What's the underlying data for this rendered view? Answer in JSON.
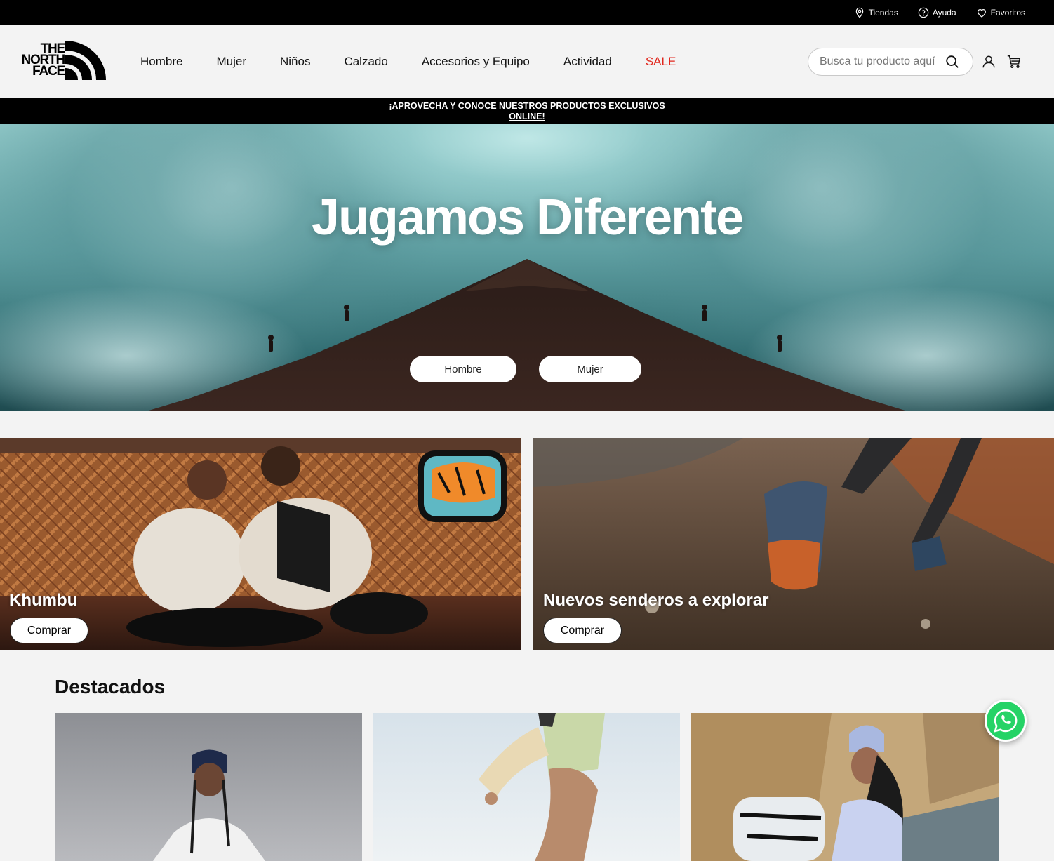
{
  "utility_bar": {
    "stores_label": "Tiendas",
    "help_label": "Ayuda",
    "favorites_label": "Favoritos"
  },
  "header": {
    "logo_lines": [
      "THE",
      "NORTH",
      "FACE"
    ],
    "nav": [
      {
        "label": "Hombre"
      },
      {
        "label": "Mujer"
      },
      {
        "label": "Niños"
      },
      {
        "label": "Calzado"
      },
      {
        "label": "Accesorios y Equipo"
      },
      {
        "label": "Actividad"
      },
      {
        "label": "SALE"
      }
    ],
    "search_placeholder": "Busca tu producto aquí"
  },
  "promo": {
    "text": "¡APROVECHA Y CONOCE NUESTROS PRODUCTOS EXCLUSIVOS",
    "link": "ONLINE!"
  },
  "hero": {
    "title": "Jugamos Diferente",
    "buttons": [
      "Hombre",
      "Mujer"
    ]
  },
  "cards": [
    {
      "title": "Khumbu",
      "button": "Comprar"
    },
    {
      "title": "Nuevos senderos a explorar",
      "button": "Comprar"
    }
  ],
  "featured": {
    "title": "Destacados"
  },
  "colors": {
    "sale": "#e1261c",
    "whatsapp": "#25d366"
  }
}
